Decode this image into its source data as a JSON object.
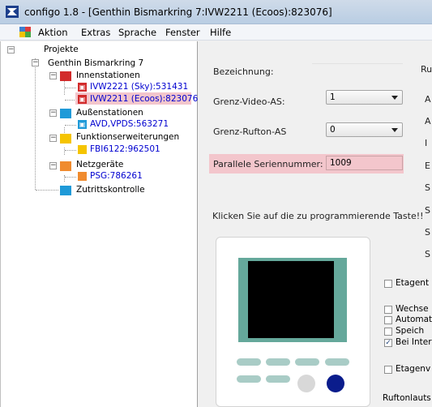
{
  "window": {
    "title": "configo 1.8 - [Genthin Bismarkring 7:IVW2211 (Ecoos):823076]"
  },
  "menu": [
    "Aktion",
    "Extras",
    "Sprache",
    "Fenster",
    "Hilfe"
  ],
  "tree": {
    "root": "Projekte",
    "project": "Genthin Bismarkring 7",
    "groups": [
      {
        "label": "Innenstationen",
        "color": "#d22b2b",
        "children": [
          "IVW2221 (Sky):531431",
          "IVW2211 (Ecoos):823076"
        ]
      },
      {
        "label": "Außenstationen",
        "color": "#1f9ad8",
        "children": [
          "AVD,VPDS:563271"
        ]
      },
      {
        "label": "Funktionserweiterungen",
        "color": "#f5c400",
        "children": [
          "FBI6122:962501"
        ]
      },
      {
        "label": "Netzgeräte",
        "color": "#f08b2e",
        "children": [
          "PSG:786261"
        ]
      },
      {
        "label": "Zutrittskontrolle",
        "color": "#1f9ad8",
        "children": []
      }
    ],
    "selected": "IVW2211 (Ecoos):823076"
  },
  "form": {
    "bezeichnung_label": "Bezeichnung:",
    "grenz_video_label": "Grenz-Video-AS:",
    "grenz_video_value": "1",
    "grenz_rufton_label": "Grenz-Rufton-AS",
    "grenz_rufton_value": "0",
    "parallele_label": "Parallele Seriennummer:",
    "parallele_value": "1009",
    "instruction": "Klicken Sie auf die zu programmierende Taste!!",
    "right_col_letters": [
      "Ru",
      "A",
      "A",
      "I",
      "E",
      "S",
      "S",
      "S",
      "S"
    ]
  },
  "options": [
    {
      "label": "Etagent",
      "checked": false
    },
    {
      "label": "Wechse",
      "checked": false
    },
    {
      "label": "Automat",
      "checked": false
    },
    {
      "label": "Speich",
      "checked": false
    },
    {
      "label": "Bei Inter",
      "checked": true
    },
    {
      "label": "Etagenv",
      "checked": false
    }
  ],
  "ruftonlaut_label": "Ruftonlauts",
  "colors": {
    "selection": "#f3c6cc",
    "device_bezel": "#65a89b",
    "device_keys": "#a9ccc6",
    "blue_key": "#0a1c8c",
    "grey_key": "#d8d8d8"
  }
}
